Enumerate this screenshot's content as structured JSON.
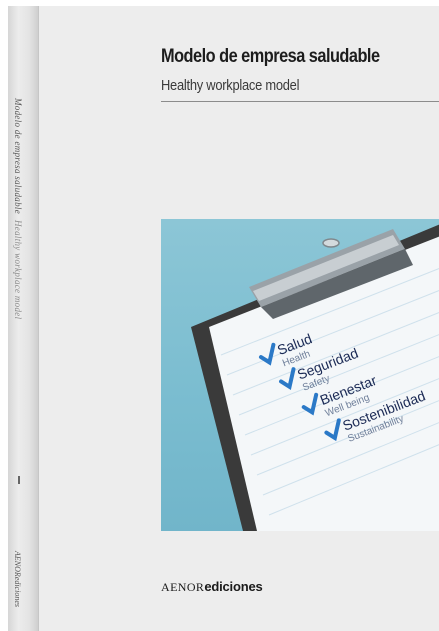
{
  "book": {
    "title": "Modelo de empresa saludable",
    "subtitle": "Healthy workplace model",
    "spine_title_es": "Modelo de empresa saludable",
    "spine_title_en": "Healthy workplace model",
    "spine_publisher": "AENORediciones",
    "publisher_prefix": "AENOR",
    "publisher_suffix": "ediciones"
  },
  "checklist": [
    {
      "label": "Salud",
      "sub": "Health"
    },
    {
      "label": "Seguridad",
      "sub": "Safety"
    },
    {
      "label": "Bienestar",
      "sub": "Well being"
    },
    {
      "label": "Sostenibilidad",
      "sub": "Sustainability"
    }
  ],
  "colors": {
    "cover_background": "#ededed",
    "photo_background": "#7bbdd0",
    "clipboard": "#3a3a3a",
    "check_mark": "#2b79c7",
    "text_dark": "#1d1d1d"
  },
  "icons": [
    "check-icon",
    "clipboard-clip-icon"
  ]
}
